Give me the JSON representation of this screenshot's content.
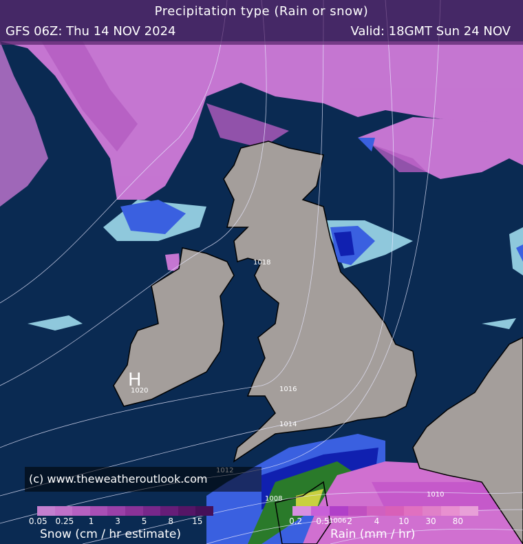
{
  "header": {
    "title": "Precipitation type (Rain or snow)",
    "run": "GFS 06Z: Thu 14 NOV 2024",
    "valid": "Valid: 18GMT Sun 24 NOV"
  },
  "credit": "(c) www.theweatheroutlook.com",
  "isobars": {
    "l1018": "1018",
    "l1016": "1016",
    "l1014": "1014",
    "l1012": "1012",
    "l1010": "1010",
    "l1008a": "1008",
    "l1008b": "1008",
    "l1006": "1006",
    "l1020": "1020",
    "high": "H"
  },
  "snow_legend": {
    "title": "Snow (cm / hr estimate)",
    "ticks": [
      "0.05",
      "0.25",
      "1",
      "3",
      "5",
      "8",
      "15"
    ],
    "colors": [
      "#c47fcf",
      "#c070c8",
      "#b560c0",
      "#a84fb5",
      "#9a40a8",
      "#8a3298",
      "#78278a",
      "#661d78",
      "#551566",
      "#451058"
    ]
  },
  "rain_legend": {
    "title": "Rain (mm / hr)",
    "ticks": [
      "0.2",
      "0.5",
      "2",
      "4",
      "10",
      "30",
      "80"
    ],
    "colors": [
      "#d890e0",
      "#c860d8",
      "#b040c8",
      "#c050c0",
      "#d060c0",
      "#d860b8",
      "#e070c0",
      "#e080c8",
      "#e890d0",
      "#e8a0d8"
    ]
  },
  "colors": {
    "sea": "#0a2a52",
    "land": "#a49e9b",
    "snow_light": "#d07ad8",
    "snow_mid": "#c264cf",
    "rain_light": "#8fc8dc",
    "rain_blue": "#3a60e0",
    "rain_dark": "#1020b0",
    "rain_green": "#2a8a2a"
  }
}
